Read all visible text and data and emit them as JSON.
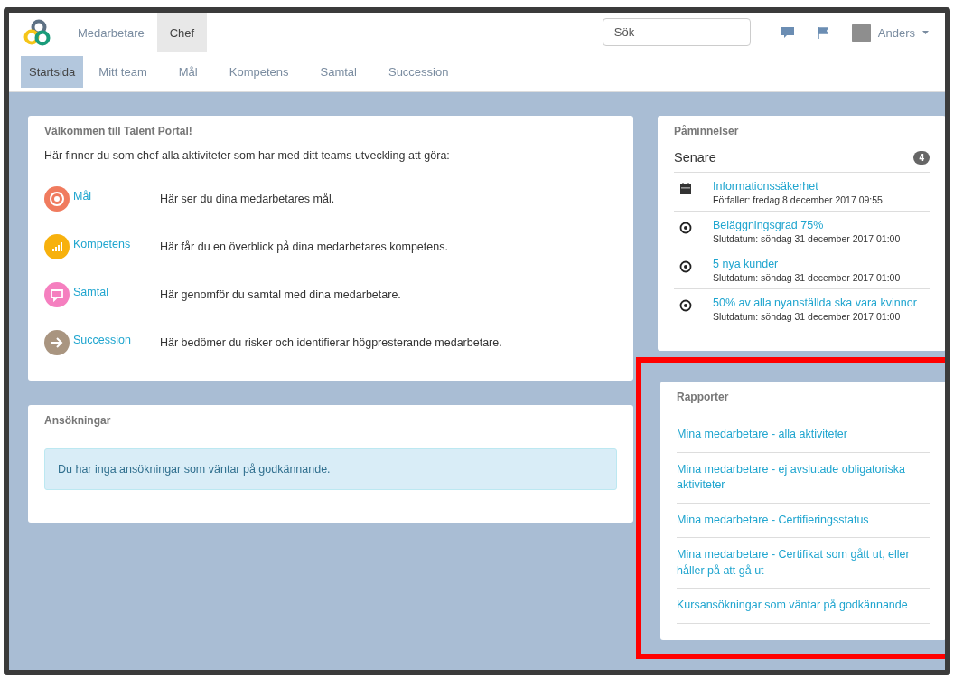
{
  "header": {
    "top_nav": [
      {
        "label": "Medarbetare",
        "selected": false
      },
      {
        "label": "Chef",
        "selected": true
      }
    ],
    "search": {
      "placeholder": "Sök"
    },
    "user": {
      "name": "Anders"
    }
  },
  "tabs": [
    {
      "label": "Startsida",
      "selected": true
    },
    {
      "label": "Mitt team",
      "selected": false
    },
    {
      "label": "Mål",
      "selected": false
    },
    {
      "label": "Kompetens",
      "selected": false
    },
    {
      "label": "Samtal",
      "selected": false
    },
    {
      "label": "Succession",
      "selected": false
    }
  ],
  "welcome": {
    "title": "Välkommen till Talent Portal!",
    "intro": "Här finner du som chef alla aktiviteter som har med ditt teams utveckling att göra:",
    "items": [
      {
        "kind": "target",
        "color": "#f07b5e",
        "link": "Mål",
        "text": "Här ser du dina medarbetares mål."
      },
      {
        "kind": "chart",
        "color": "#f7b10d",
        "link": "Kompetens",
        "text": "Här får du en överblick på dina medarbetares kompetens."
      },
      {
        "kind": "chat",
        "color": "#f57fbf",
        "link": "Samtal",
        "text": "Här genomför du samtal med dina medarbetare."
      },
      {
        "kind": "arrow",
        "color": "#a99580",
        "link": "Succession",
        "text": "Här bedömer du risker och identifierar högpresterande medarbetare."
      }
    ]
  },
  "applications": {
    "title": "Ansökningar",
    "message": "Du har inga ansökningar som väntar på godkännande."
  },
  "reminders": {
    "title": "Påminnelser",
    "group": "Senare",
    "count": "4",
    "items": [
      {
        "kind": "calendar",
        "title": "Informationssäkerhet",
        "date": "Förfaller: fredag 8 december 2017 09:55"
      },
      {
        "kind": "target",
        "title": "Beläggningsgrad 75%",
        "date": "Slutdatum: söndag 31 december 2017 01:00"
      },
      {
        "kind": "target",
        "title": "5 nya kunder",
        "date": "Slutdatum: söndag 31 december 2017 01:00"
      },
      {
        "kind": "target",
        "title": "50% av alla nyanställda ska vara kvinnor",
        "date": "Slutdatum: söndag 31 december 2017 01:00"
      }
    ]
  },
  "reports": {
    "title": "Rapporter",
    "highlighted": true,
    "links": [
      "Mina medarbetare - alla aktiviteter",
      "Mina medarbetare - ej avslutade obligatoriska aktiviteter",
      "Mina medarbetare - Certifieringsstatus",
      "Mina medarbetare - Certifikat som gått ut, eller håller på att gå ut",
      "Kursansökningar som väntar på godkännande"
    ]
  }
}
